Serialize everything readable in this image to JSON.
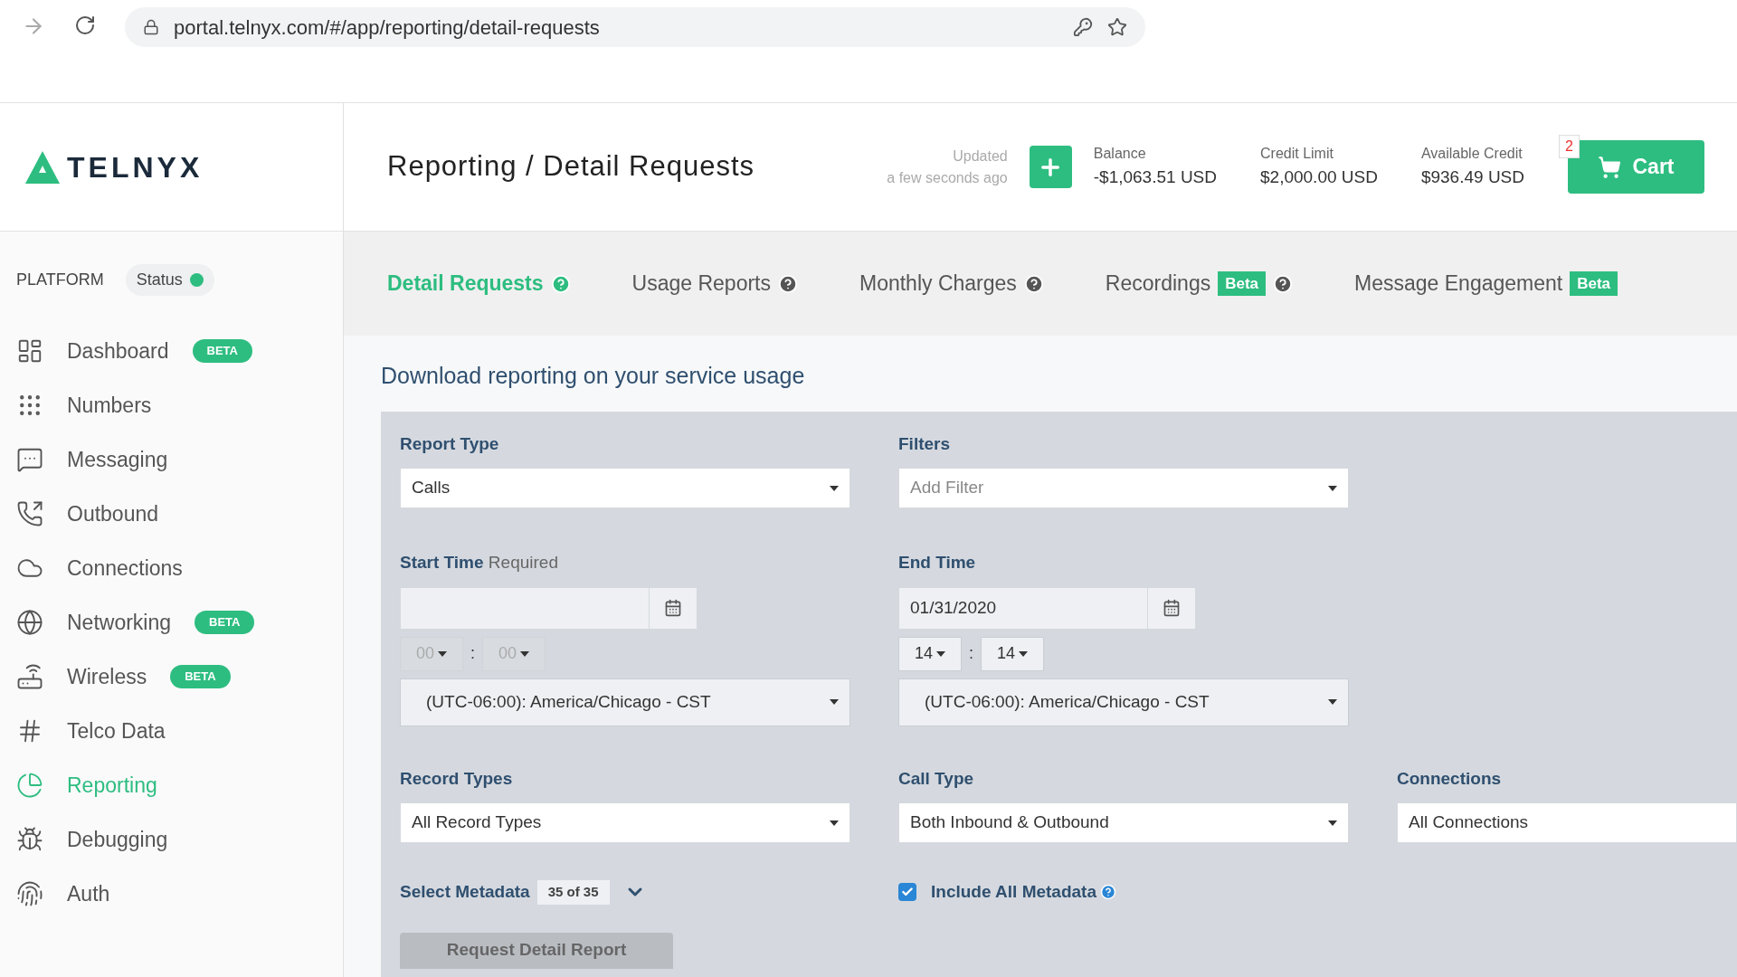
{
  "browser": {
    "url": "portal.telnyx.com/#/app/reporting/detail-requests"
  },
  "header": {
    "logo": "TELNYX",
    "title": "Reporting / Detail Requests",
    "updated_label": "Updated",
    "updated_time": "a few seconds ago",
    "stats": [
      {
        "label": "Balance",
        "value": "-$1,063.51 USD"
      },
      {
        "label": "Credit Limit",
        "value": "$2,000.00 USD"
      },
      {
        "label": "Available Credit",
        "value": "$936.49 USD"
      }
    ],
    "cart": {
      "label": "Cart",
      "count": "2"
    }
  },
  "sidebar": {
    "section": "PLATFORM",
    "status": "Status",
    "items": [
      {
        "label": "Dashboard",
        "badge": "BETA",
        "selected": false
      },
      {
        "label": "Numbers",
        "selected": false
      },
      {
        "label": "Messaging",
        "selected": false
      },
      {
        "label": "Outbound",
        "selected": false
      },
      {
        "label": "Connections",
        "selected": false
      },
      {
        "label": "Networking",
        "badge": "BETA",
        "selected": false
      },
      {
        "label": "Wireless",
        "badge": "BETA",
        "selected": false
      },
      {
        "label": "Telco Data",
        "selected": false
      },
      {
        "label": "Reporting",
        "selected": true
      },
      {
        "label": "Debugging",
        "selected": false
      },
      {
        "label": "Auth",
        "selected": false
      }
    ]
  },
  "tabs": [
    {
      "label": "Detail Requests",
      "help": true,
      "selected": true
    },
    {
      "label": "Usage Reports",
      "help": true,
      "selected": false
    },
    {
      "label": "Monthly Charges",
      "help": true,
      "selected": false
    },
    {
      "label": "Recordings",
      "badge": "Beta",
      "help": true,
      "selected": false
    },
    {
      "label": "Message Engagement",
      "badge": "Beta",
      "help": false,
      "selected": false
    }
  ],
  "content": {
    "heading": "Download reporting on your service usage",
    "report_type": {
      "label": "Report Type",
      "value": "Calls"
    },
    "filters": {
      "label": "Filters",
      "placeholder": "Add Filter"
    },
    "start_time": {
      "label": "Start Time",
      "note": "Required",
      "hour": "00",
      "minute": "00",
      "disabled": true,
      "timezone": "(UTC-06:00): America/Chicago - CST"
    },
    "end_time": {
      "label": "End Time",
      "date": "01/31/2020",
      "hour": "14",
      "minute": "14",
      "disabled": false,
      "timezone": "(UTC-06:00): America/Chicago - CST"
    },
    "time_separator": ":",
    "record_types": {
      "label": "Record Types",
      "value": "All Record Types"
    },
    "call_type": {
      "label": "Call Type",
      "value": "Both Inbound & Outbound"
    },
    "connections": {
      "label": "Connections",
      "value": "All Connections"
    },
    "metadata": {
      "label": "Select Metadata",
      "count": "35 of 35"
    },
    "include_all": {
      "label": "Include All Metadata",
      "checked": true
    },
    "submit": "Request Detail Report"
  }
}
